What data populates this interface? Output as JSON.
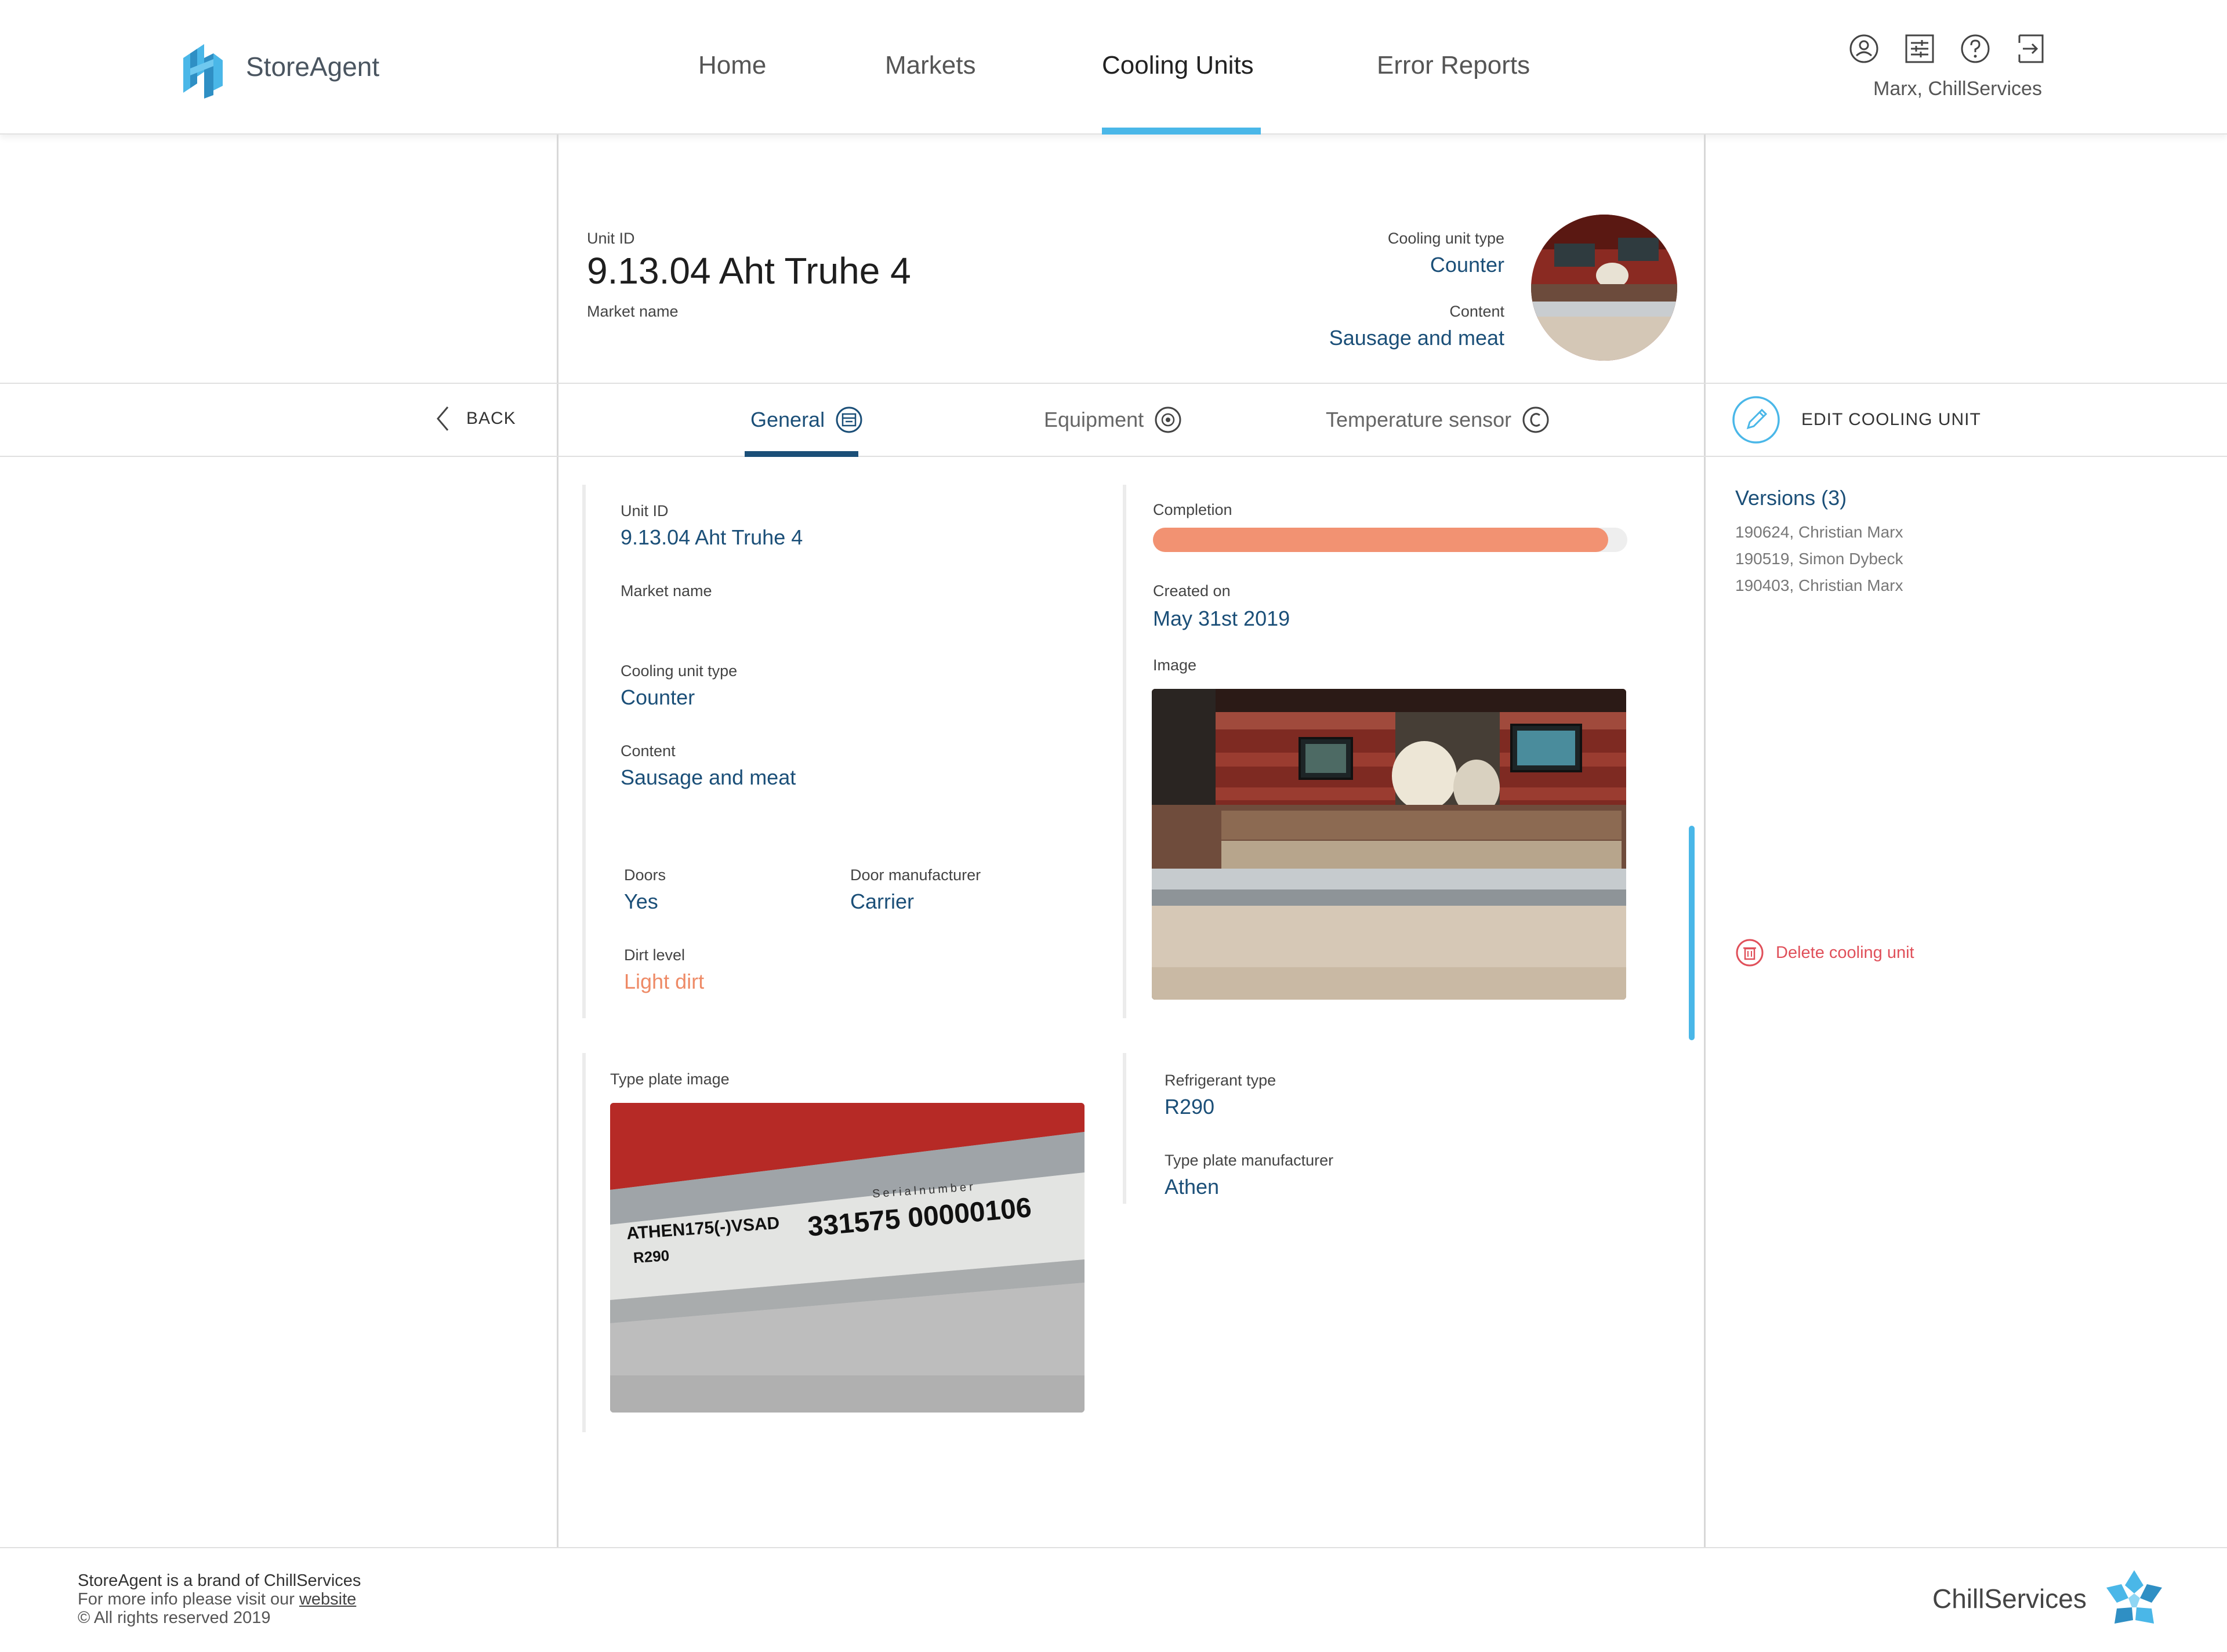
{
  "brand": {
    "name": "StoreAgent"
  },
  "nav": {
    "home": "Home",
    "markets": "Markets",
    "cooling_units": "Cooling Units",
    "error_reports": "Error Reports"
  },
  "user": {
    "name": "Marx, ChillServices"
  },
  "icons": {
    "profile": "user-icon",
    "settings": "sliders-icon",
    "help": "help-icon",
    "logout": "logout-icon"
  },
  "colors": {
    "accent": "#4ab7e8",
    "value": "#1b4f78",
    "dirt": "#ee8a66",
    "progress": "#f29272",
    "delete": "#e0505a"
  },
  "unit_header": {
    "unit_id_label": "Unit ID",
    "unit_id": "9.13.04 Aht Truhe 4",
    "market_name_label": "Market name",
    "type_label": "Cooling unit type",
    "type": "Counter",
    "content_label": "Content",
    "content": "Sausage and meat"
  },
  "back_label": "BACK",
  "tabs": {
    "general": "General",
    "equipment": "Equipment",
    "temperature_sensor": "Temperature sensor"
  },
  "edit_label": "EDIT COOLING UNIT",
  "versions": {
    "title": "Versions (3)",
    "items": [
      "190624, Christian Marx",
      "190519, Simon Dybeck",
      "190403, Christian Marx"
    ]
  },
  "delete_label": "Delete cooling unit",
  "general": {
    "unit_id_label": "Unit ID",
    "unit_id": "9.13.04 Aht Truhe 4",
    "market_name_label": "Market name",
    "type_label": "Cooling unit type",
    "type": "Counter",
    "content_label": "Content",
    "content": "Sausage and meat",
    "completion_label": "Completion",
    "completion": 0.96,
    "created_label": "Created on",
    "created": "May 31st 2019",
    "image_label": "Image",
    "doors_label": "Doors",
    "doors": "Yes",
    "door_manufacturer_label": "Door manufacturer",
    "door_manufacturer": "Carrier",
    "dirt_label": "Dirt level",
    "dirt": "Light dirt",
    "type_plate_image_label": "Type plate image",
    "refrigerant_label": "Refrigerant type",
    "refrigerant": "R290",
    "plate_manufacturer_label": "Type plate manufacturer",
    "plate_manufacturer": "Athen"
  },
  "type_plate": {
    "model": "ATHEN175(-)VSAD",
    "refrigerant": "R290",
    "serial_caption": "Serialnumber",
    "serial": "331575 00000106"
  },
  "footer": {
    "line1": "StoreAgent is a brand of ChillServices",
    "line2_prefix": "For more info please visit our ",
    "link": "website",
    "line3": "© All rights reserved 2019",
    "brand": "ChillServices"
  }
}
